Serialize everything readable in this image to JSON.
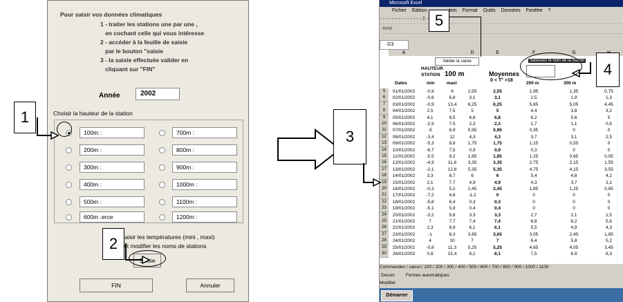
{
  "dialog": {
    "intro": "Pour saisir vos données climatiques",
    "instructions": "1 - traiter les stations une par une ,\n   en cochant celle qui vous intéresse\n2 - accéder à la feuille de saisie\n   par le bouton \"saisie\n3 - la saisie effectuée valider en\n   cliquant sur \"FIN\"",
    "year_label": "Année",
    "year_value": "2002",
    "station_label": "Choisir la hauteur de la station",
    "left_options": [
      "100m :",
      "200m :",
      "300m :",
      "400m :",
      "500m :",
      "600m :erce"
    ],
    "right_options": [
      "700m :",
      "800m :",
      "900m :",
      "1000m :",
      "1100m :",
      "1200m :"
    ],
    "temp_note_1": "Saisir les températures (mini , maxi)",
    "temp_note_2": "et modifier les noms de stations",
    "saisie_label": "Saisie",
    "fin_label": "FIN",
    "cancel_label": "Annuler"
  },
  "callouts": {
    "c1": "1",
    "c2": "2",
    "c3": "3",
    "c4": "4",
    "c5": "5"
  },
  "excel": {
    "title": "Microsoft Excel",
    "menus": [
      "Fichier",
      "Édition",
      "tion",
      "Format",
      "Outils",
      "Données",
      "Fenêtre",
      "?"
    ],
    "font": "Arial",
    "cell_ref": "G3",
    "col_headers": [
      "A",
      "",
      "D",
      "E",
      "F",
      "G",
      "H"
    ],
    "validate_button": "Valider la saisie",
    "station_name_prompt": "Saisissez le nom de la station",
    "header_hauteur": "HAUTEUR",
    "header_station": "STATION",
    "header_altitude": "100 m",
    "header_moyennes": "Moyennes",
    "header_range": "0 < T° >18",
    "header_200": "200 m",
    "header_300": "300 m",
    "header_dates": "Dates",
    "header_min": "min",
    "header_max": "maxi",
    "rows": [
      [
        "5",
        "01/01/2002",
        "-0,9",
        "6",
        "2,55",
        "2,55",
        "1,95",
        "1,35",
        "0,75"
      ],
      [
        "6",
        "02/01/2002",
        "-0,6",
        "6,8",
        "3,1",
        "3,1",
        "2,5",
        "1,9",
        "1,3"
      ],
      [
        "7",
        "03/01/2002",
        "-0,9",
        "13,4",
        "6,25",
        "6,25",
        "5,65",
        "5,05",
        "4,45"
      ],
      [
        "8",
        "04/01/2002",
        "2,5",
        "7,5",
        "5",
        "5",
        "4,4",
        "3,8",
        "3,2"
      ],
      [
        "9",
        "05/01/2002",
        "4,1",
        "9,5",
        "6,8",
        "6,8",
        "6,2",
        "5,6",
        "5"
      ],
      [
        "10",
        "06/01/2002",
        "-2,9",
        "7,5",
        "2,3",
        "2,3",
        "1,7",
        "1,1",
        "0,5"
      ],
      [
        "11",
        "07/01/2002",
        "-5",
        "6,9",
        "0,95",
        "0,95",
        "0,35",
        "0",
        "0"
      ],
      [
        "12",
        "08/01/2002",
        "-3,4",
        "12",
        "4,3",
        "4,3",
        "3,7",
        "3,1",
        "2,5"
      ],
      [
        "13",
        "09/01/2002",
        "-5,3",
        "8,8",
        "1,75",
        "1,75",
        "1,15",
        "0,55",
        "0"
      ],
      [
        "14",
        "10/01/2002",
        "-6,7",
        "7,5",
        "0,9",
        "0,9",
        "0,3",
        "0",
        "0"
      ],
      [
        "15",
        "11/01/2002",
        "-5,5",
        "9,2",
        "1,85",
        "1,85",
        "1,25",
        "0,65",
        "0,05"
      ],
      [
        "16",
        "12/01/2002",
        "-4,9",
        "11,6",
        "3,35",
        "3,35",
        "2,75",
        "2,15",
        "1,55"
      ],
      [
        "17",
        "13/01/2002",
        "-2,1",
        "12,8",
        "5,35",
        "5,35",
        "4,75",
        "4,15",
        "3,55"
      ],
      [
        "18",
        "14/01/2002",
        "3,3",
        "8,7",
        "6",
        "6",
        "5,4",
        "4,8",
        "4,2"
      ],
      [
        "19",
        "15/01/2002",
        "2,1",
        "7,7",
        "4,9",
        "4,9",
        "4,3",
        "3,7",
        "3,1"
      ],
      [
        "20",
        "16/01/2002",
        "-0,3",
        "5,2",
        "2,45",
        "2,45",
        "1,85",
        "1,25",
        "0,65"
      ],
      [
        "21",
        "17/01/2002",
        "-7,2",
        "4,8",
        "-1,2",
        "0",
        "0",
        "0",
        "0"
      ],
      [
        "22",
        "18/01/2002",
        "-5,8",
        "6,4",
        "0,3",
        "0,3",
        "0",
        "0",
        "0"
      ],
      [
        "23",
        "19/01/2002",
        "-5,1",
        "5,9",
        "0,4",
        "0,4",
        "0",
        "0",
        "0"
      ],
      [
        "24",
        "20/01/2002",
        "-3,2",
        "9,8",
        "3,3",
        "3,3",
        "2,7",
        "2,1",
        "1,5"
      ],
      [
        "25",
        "21/01/2002",
        "7",
        "7,7",
        "7,4",
        "7,4",
        "6,8",
        "6,2",
        "5,6"
      ],
      [
        "26",
        "22/01/2002",
        "2,3",
        "9,9",
        "6,1",
        "6,1",
        "5,5",
        "4,9",
        "4,3"
      ],
      [
        "27",
        "23/01/2002",
        "-1",
        "8,3",
        "3,65",
        "3,65",
        "3,05",
        "2,45",
        "1,85"
      ],
      [
        "28",
        "24/01/2002",
        "4",
        "10",
        "7",
        "7",
        "6,4",
        "5,8",
        "5,2"
      ],
      [
        "29",
        "25/01/2002",
        "-0,8",
        "11,3",
        "5,25",
        "5,25",
        "4,65",
        "4,05",
        "3,45"
      ],
      [
        "30",
        "26/01/2002",
        "0,8",
        "15,4",
        "8,1",
        "8,1",
        "7,5",
        "6,9",
        "6,3"
      ]
    ],
    "sheet_tabs": "Commandes / calcul / 100 / 200 / 300 / 400 / 500 / 600 / 700 / 800 / 900 / 1000 / 1100",
    "draw_label": "Dessin",
    "autoshapes_label": "Formes automatiques",
    "status": "Modifier",
    "start_label": "Démarrer"
  },
  "colors": {
    "dialog_bg": "#ece9e1",
    "excel_bg": "#d4d0c8",
    "titlebar": "#0a246a",
    "taskbar": "#3a6ea5"
  }
}
